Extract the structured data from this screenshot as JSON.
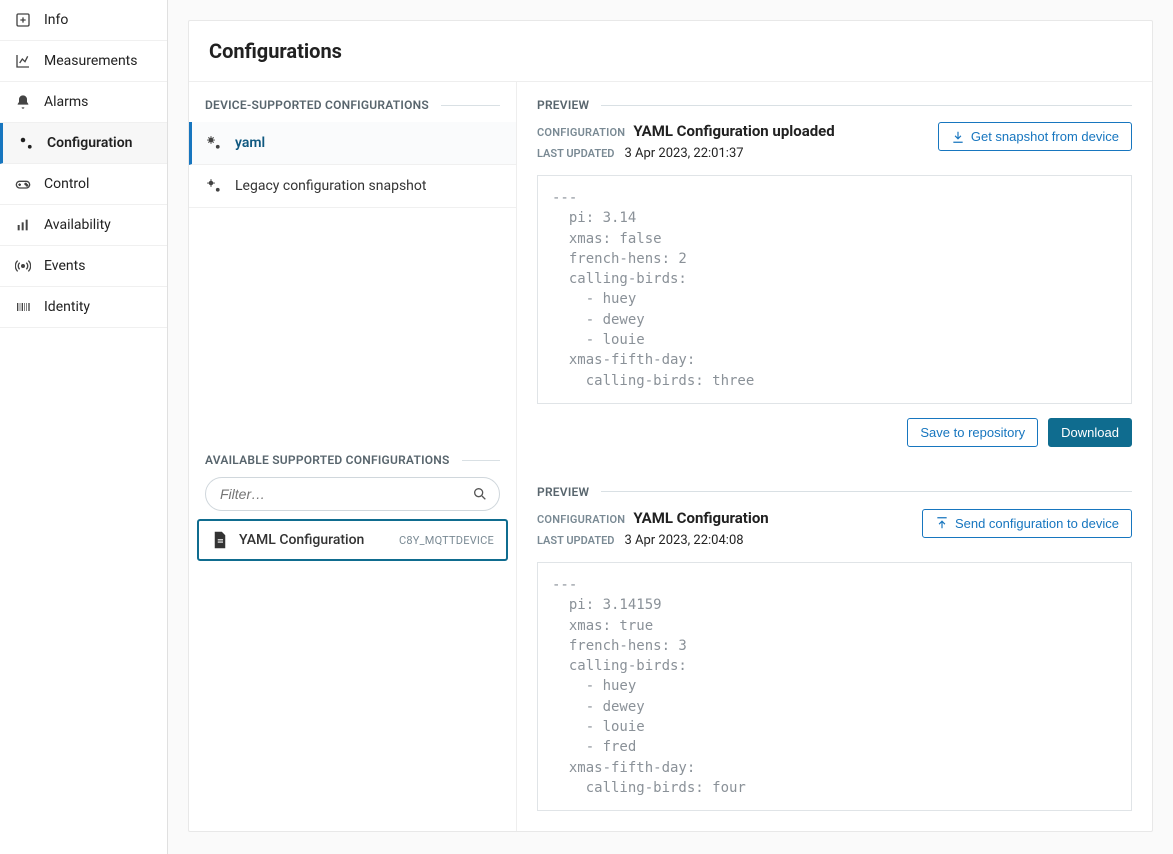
{
  "sidebar": {
    "items": [
      {
        "label": "Info"
      },
      {
        "label": "Measurements"
      },
      {
        "label": "Alarms"
      },
      {
        "label": "Configuration"
      },
      {
        "label": "Control"
      },
      {
        "label": "Availability"
      },
      {
        "label": "Events"
      },
      {
        "label": "Identity"
      }
    ]
  },
  "page": {
    "title": "Configurations"
  },
  "deviceConfigs": {
    "heading": "DEVICE-SUPPORTED CONFIGURATIONS",
    "items": [
      {
        "label": "yaml"
      },
      {
        "label": "Legacy configuration snapshot"
      }
    ]
  },
  "availableConfigs": {
    "heading": "AVAILABLE SUPPORTED CONFIGURATIONS",
    "filterPlaceholder": "Filter…",
    "items": [
      {
        "name": "YAML Configuration",
        "tag": "C8Y_MQTTDEVICE"
      }
    ]
  },
  "preview1": {
    "heading": "PREVIEW",
    "configKey": "CONFIGURATION",
    "configValue": "YAML Configuration uploaded",
    "updatedKey": "LAST UPDATED",
    "updatedValue": "3 Apr 2023, 22:01:37",
    "snapshotBtn": "Get snapshot from device",
    "code": "---\n  pi: 3.14\n  xmas: false\n  french-hens: 2\n  calling-birds:\n    - huey\n    - dewey\n    - louie\n  xmas-fifth-day:\n    calling-birds: three",
    "saveBtn": "Save to repository",
    "downloadBtn": "Download"
  },
  "preview2": {
    "heading": "PREVIEW",
    "configKey": "CONFIGURATION",
    "configValue": "YAML Configuration",
    "updatedKey": "LAST UPDATED",
    "updatedValue": "3 Apr 2023, 22:04:08",
    "sendBtn": "Send configuration to device",
    "code": "---\n  pi: 3.14159\n  xmas: true\n  french-hens: 3\n  calling-birds:\n    - huey\n    - dewey\n    - louie\n    - fred\n  xmas-fifth-day:\n    calling-birds: four"
  }
}
